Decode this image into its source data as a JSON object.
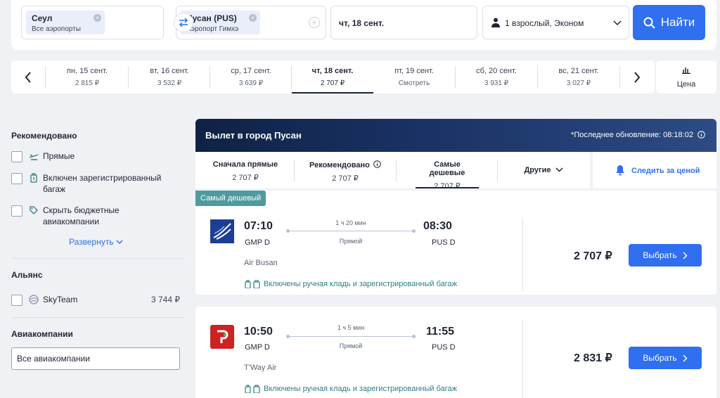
{
  "search": {
    "from_city": "Сеул",
    "from_airport": "Все аэропорты",
    "to_city": "Пусан (PUS)",
    "to_airport": "Аэропорт Гимхэ",
    "date": "чт, 18 сент.",
    "passengers": "1 взрослый, Эконом",
    "find_label": "Найти"
  },
  "date_strip": {
    "days": [
      {
        "name": "пн, 15 сент.",
        "price": "2 815 ₽"
      },
      {
        "name": "вт, 16 сент.",
        "price": "3 532 ₽"
      },
      {
        "name": "ср, 17 сент.",
        "price": "3 639 ₽"
      },
      {
        "name": "чт, 18 сент.",
        "price": "2 707 ₽"
      },
      {
        "name": "пт, 19 сент.",
        "price": "Смотреть"
      },
      {
        "name": "сб, 20 сент.",
        "price": "3 931 ₽"
      },
      {
        "name": "вс, 21 сент.",
        "price": "3 027 ₽"
      }
    ],
    "price_label": "Цена"
  },
  "sidebar": {
    "recommended_title": "Рекомендовано",
    "filters": [
      "Прямые",
      "Включен зарегистрированный багаж",
      "Скрыть бюджетные авиакомпании"
    ],
    "expand_label": "Развернуть",
    "alliance_title": "Альянс",
    "alliance_name": "SkyTeam",
    "alliance_price": "3 744 ₽",
    "airlines_title": "Авиакомпании",
    "airlines_all": "Все авиакомпании"
  },
  "results": {
    "title": "Вылет в город Пусан",
    "updated": "*Последнее обновление: 08:18:02",
    "sort": [
      {
        "label": "Сначала прямые",
        "price": "2 707 ₽"
      },
      {
        "label": "Рекомендовано",
        "price": "2 707 ₽"
      },
      {
        "label": "Самые дешевые",
        "price": "2 707 ₽"
      },
      {
        "label": "Другие",
        "price": ""
      }
    ],
    "track_label": "Следить за ценой",
    "cheapest_badge": "Самый дешевый",
    "flights": [
      {
        "depart": "07:10",
        "depart_apt": "GMP D",
        "arrive": "08:30",
        "arrive_apt": "PUS D",
        "duration": "1 ч 20 мин",
        "stops": "Прямой",
        "airline": "Air Busan",
        "baggage": "Включены ручная кладь и зарегистрированный багаж",
        "price": "2 707 ₽",
        "select": "Выбрать",
        "logo_color": "#1d3e96"
      },
      {
        "depart": "10:50",
        "depart_apt": "GMP D",
        "arrive": "11:55",
        "arrive_apt": "PUS D",
        "duration": "1 ч 5 мин",
        "stops": "Прямой",
        "airline": "T'Way Air",
        "baggage": "Включены ручная кладь и зарегистрированный багаж",
        "price": "2 831 ₽",
        "select": "Выбрать",
        "logo_color": "#cc2222"
      }
    ]
  }
}
